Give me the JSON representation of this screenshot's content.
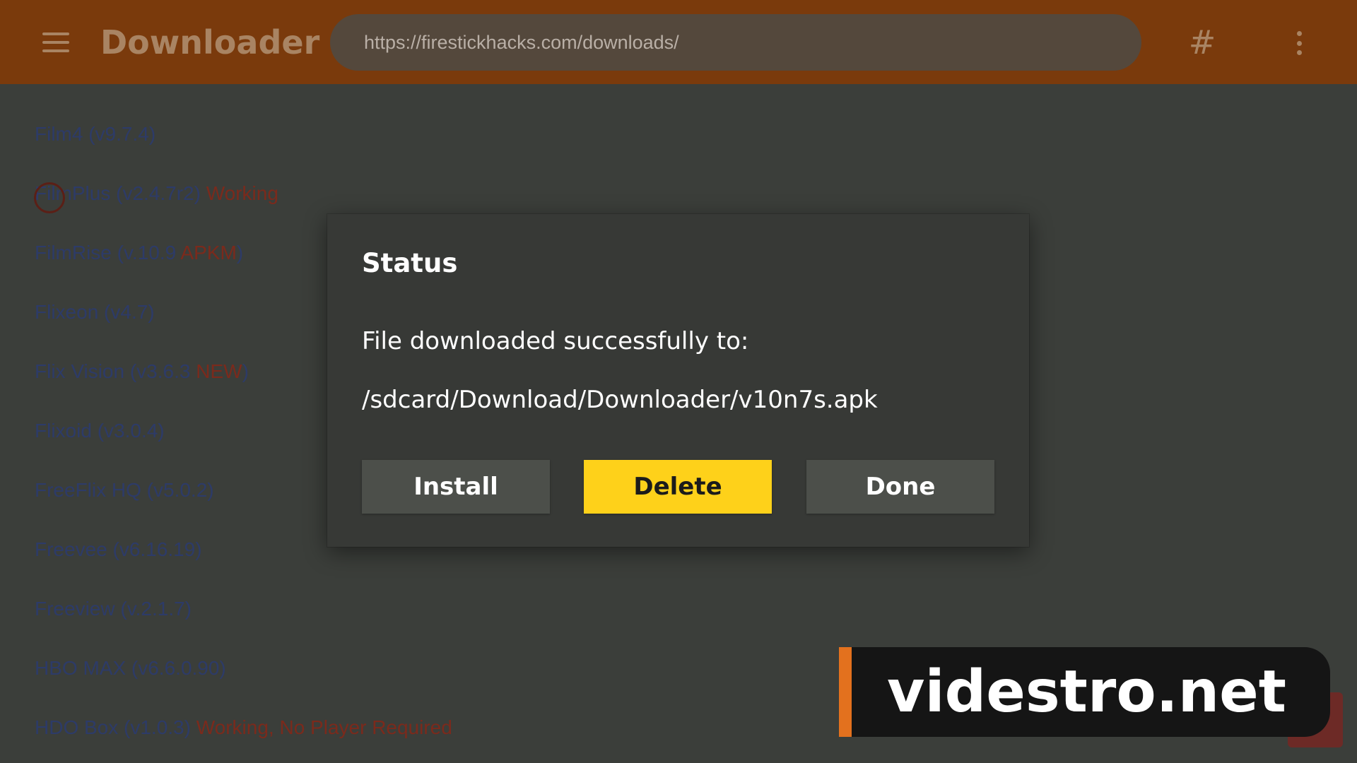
{
  "app": {
    "title": "Downloader",
    "url": "https://firestickhacks.com/downloads/",
    "hash_label": "#"
  },
  "list": {
    "items": [
      {
        "name": "Film4 (v9.7.4)",
        "tag": "",
        "suffix": ""
      },
      {
        "name": "FilmPlus (v2.4.7r2) ",
        "tag": "Working",
        "suffix": ""
      },
      {
        "name": "FilmRise (v.10.9 ",
        "tag": "APKM",
        "suffix": ")"
      },
      {
        "name": "Flixeon (v4.7)",
        "tag": "",
        "suffix": ""
      },
      {
        "name": "Flix Vision (v3.6.3 ",
        "tag": "NEW",
        "suffix": ")"
      },
      {
        "name": "Flixoid (v3.0.4)",
        "tag": "",
        "suffix": ""
      },
      {
        "name": "FreeFlix HQ (v5.0.2)",
        "tag": "",
        "suffix": ""
      },
      {
        "name": "Freevee (v6.16.19)",
        "tag": "",
        "suffix": ""
      },
      {
        "name": "Freeview (v.2.1.7)",
        "tag": "",
        "suffix": ""
      },
      {
        "name": "HBO MAX (v6.6.0.90)",
        "tag": "",
        "suffix": ""
      },
      {
        "name": "HDO Box (v1.0.3) ",
        "tag": "Working, No Player Required",
        "suffix": ""
      }
    ]
  },
  "dialog": {
    "title": "Status",
    "message": "File downloaded successfully to:",
    "path": "/sdcard/Download/Downloader/v10n7s.apk",
    "buttons": {
      "install": "Install",
      "delete": "Delete",
      "done": "Done"
    }
  },
  "watermark": {
    "text": "videstro.net"
  },
  "colors": {
    "topbar": "#7a3a0c",
    "accent_yellow": "#fed11a",
    "dialog_bg": "#373936",
    "link_text": "#2d3b68",
    "tag_text": "#7b2a1c",
    "watermark_accent": "#e3711e"
  },
  "icons": {
    "menu": "hamburger-menu-icon",
    "more": "kebab-menu-icon"
  }
}
